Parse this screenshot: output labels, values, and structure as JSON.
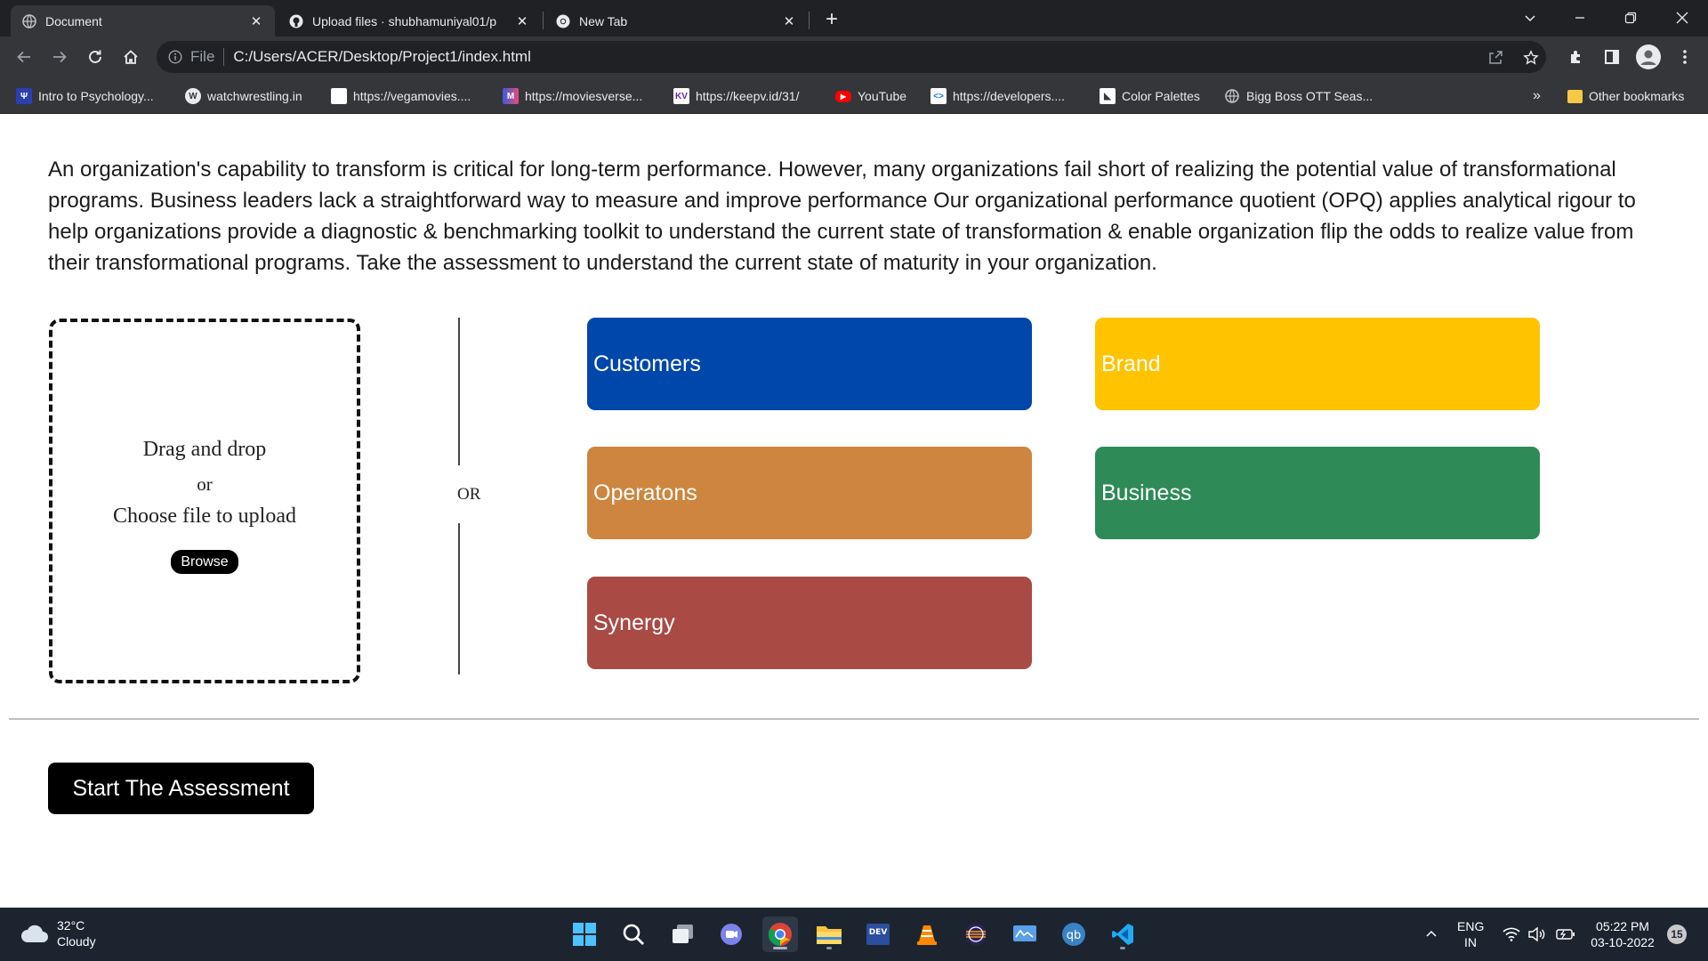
{
  "browser": {
    "tabs": [
      {
        "title": "Document",
        "icon": "globe-icon"
      },
      {
        "title": "Upload files · shubhamuniyal01/p",
        "icon": "github-icon"
      },
      {
        "title": "New Tab",
        "icon": "chrome-icon"
      }
    ],
    "address": {
      "scheme": "File",
      "url": "C:/Users/ACER/Desktop/Project1/index.html"
    },
    "bookmarks": [
      {
        "label": "Intro to Psychology...",
        "icon": "psych-icon"
      },
      {
        "label": "watchwrestling.in",
        "icon": "wordpress-icon"
      },
      {
        "label": "https://vegamovies....",
        "icon": "blank-page-icon"
      },
      {
        "label": "https://moviesverse...",
        "icon": "moviesverse-icon"
      },
      {
        "label": "https://keepv.id/31/",
        "icon": "keepv-icon"
      },
      {
        "label": "YouTube",
        "icon": "youtube-icon"
      },
      {
        "label": "https://developers....",
        "icon": "developers-icon"
      },
      {
        "label": "Color Palettes",
        "icon": "palette-icon"
      },
      {
        "label": "Bigg Boss OTT Seas...",
        "icon": "globe-icon"
      }
    ],
    "bookmarks_overflow": "»",
    "other_bookmarks": "Other bookmarks"
  },
  "page": {
    "intro": "An organization's capability to transform is critical for long-term performance. However, many organizations fail short of realizing the potential value of transformational programs. Business leaders lack a straightforward way to measure and improve performance Our organizational performance quotient (OPQ) applies analytical rigour to help organizations provide a diagnostic & benchmarking toolkit to understand the current state of transformation & enable organization flip the odds to realize value from their transformational programs. Take the assessment to understand the current state of maturity in your organization.",
    "dropzone": {
      "line1": "Drag and drop",
      "or": "or",
      "line2": "Choose file to upload",
      "browse": "Browse"
    },
    "or_label": "OR",
    "categories": [
      {
        "label": "Customers",
        "color": "#0047ab"
      },
      {
        "label": "Brand",
        "color": "#ffc300"
      },
      {
        "label": "Operatons",
        "color": "#cd853f"
      },
      {
        "label": "Business",
        "color": "#2e8b57"
      },
      {
        "label": "Synergy",
        "color": "#a94a45"
      }
    ],
    "start_button": "Start The Assessment"
  },
  "taskbar": {
    "weather": {
      "temp": "32°C",
      "condition": "Cloudy"
    },
    "apps": [
      "windows-start-icon",
      "search-icon",
      "task-view-icon",
      "teams-chat-icon",
      "chrome-icon",
      "file-explorer-icon",
      "dev-icon",
      "vlc-icon",
      "eclipse-icon",
      "monitor-icon",
      "qbittorrent-icon",
      "vscode-icon"
    ],
    "language": {
      "line1": "ENG",
      "line2": "IN"
    },
    "clock": {
      "time": "05:22 PM",
      "date": "03-10-2022"
    },
    "notifications": "15"
  }
}
